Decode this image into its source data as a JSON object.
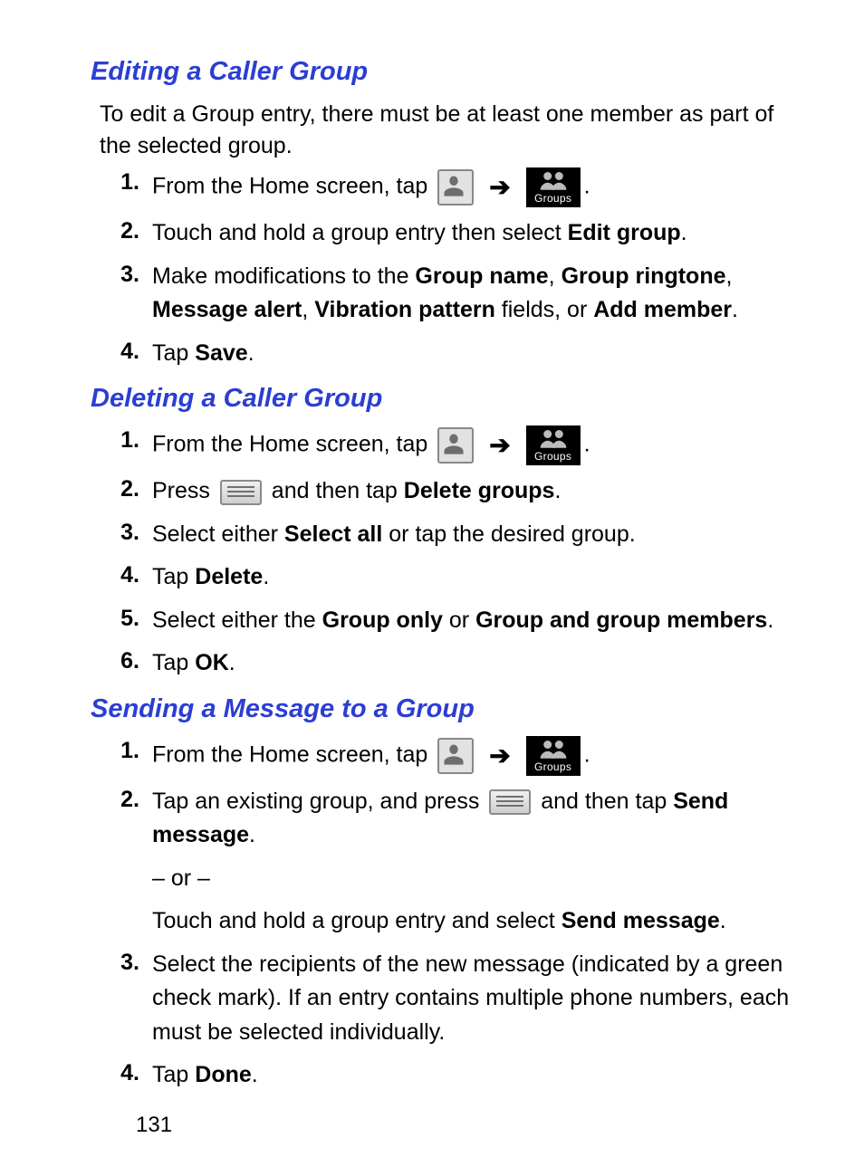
{
  "pageNumber": "131",
  "groupsLabel": "Groups",
  "sections": {
    "edit": {
      "heading": "Editing a Caller Group",
      "intro": "To edit a Group entry, there must be at least one member as part of the selected group.",
      "step1_pre": "From the Home screen, tap ",
      "step2_a": "Touch and hold a group entry then select ",
      "step2_b": "Edit group",
      "step3_a": "Make modifications to the ",
      "step3_b": "Group name",
      "step3_c": ", ",
      "step3_d": "Group ringtone",
      "step3_e": ", ",
      "step3_f": "Message alert",
      "step3_g": ", ",
      "step3_h": "Vibration pattern",
      "step3_i": " fields, or ",
      "step3_j": "Add member",
      "step4_a": "Tap ",
      "step4_b": "Save"
    },
    "delete": {
      "heading": "Deleting a Caller Group",
      "step1_pre": "From the Home screen, tap ",
      "step2_a": "Press ",
      "step2_b": " and then tap ",
      "step2_c": "Delete groups",
      "step3_a": "Select either ",
      "step3_b": "Select all",
      "step3_c": " or tap the desired group.",
      "step4_a": "Tap ",
      "step4_b": "Delete",
      "step5_a": "Select either the ",
      "step5_b": "Group only",
      "step5_c": " or ",
      "step5_d": "Group and group members",
      "step6_a": "Tap ",
      "step6_b": "OK"
    },
    "send": {
      "heading": "Sending a Message to a Group",
      "step1_pre": "From the Home screen, tap ",
      "step2_a": "Tap an existing group, and press ",
      "step2_b": " and then tap ",
      "step2_c": "Send message",
      "step2_or": "– or –",
      "step2_d": "Touch and hold a group entry and select ",
      "step2_e": "Send message",
      "step3": "Select the recipients of the new message (indicated by a green check mark). If an entry contains multiple phone numbers, each must be selected individually.",
      "step4_a": "Tap ",
      "step4_b": "Done"
    }
  }
}
